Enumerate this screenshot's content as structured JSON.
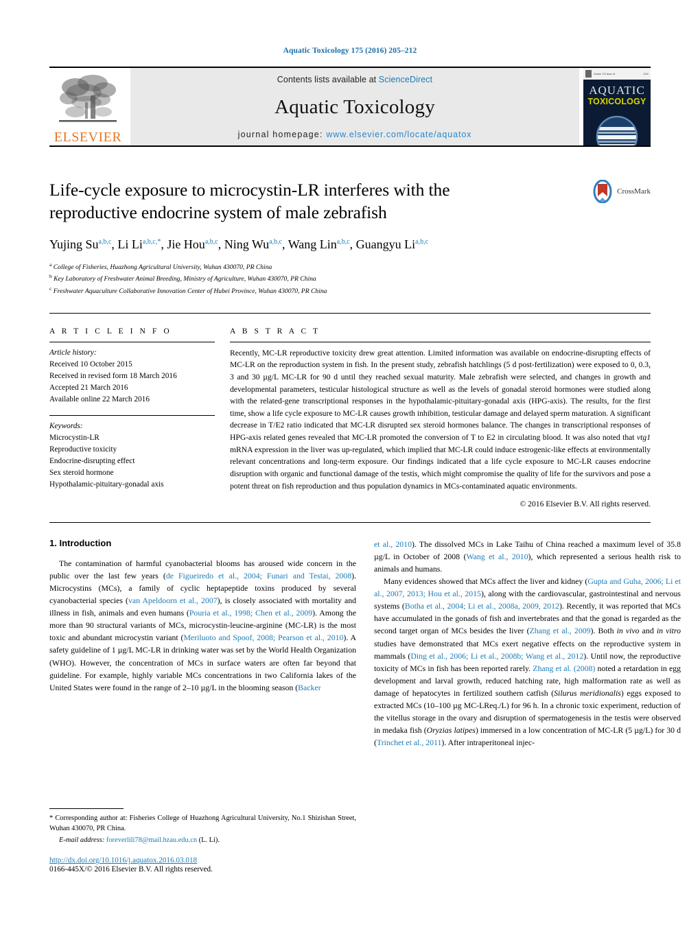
{
  "running_head": "Aquatic Toxicology 175 (2016) 205–212",
  "masthead": {
    "elsevier_label": "ELSEVIER",
    "contents_prefix": "Contents lists available at ",
    "contents_link": "ScienceDirect",
    "journal_title": "Aquatic Toxicology",
    "homepage_prefix": "journal homepage:",
    "homepage_url": "www.elsevier.com/locate/aquatox",
    "cover": {
      "line_aquatic": "AQUATIC",
      "line_toxicology": "TOXICOLOGY",
      "top_left_tiny": "Volume 175  Issue 01",
      "top_right_tiny": "2016"
    }
  },
  "article": {
    "title": "Life-cycle exposure to microcystin-LR interferes with the reproductive endocrine system of male zebrafish",
    "crossmark_label": "CrossMark",
    "authors": [
      {
        "name": "Yujing Su",
        "sup": "a,b,c"
      },
      {
        "name": "Li Li",
        "sup": "a,b,c,"
      },
      {
        "name": "Jie Hou",
        "sup": "a,b,c"
      },
      {
        "name": "Ning Wu",
        "sup": "a,b,c"
      },
      {
        "name": "Wang Lin",
        "sup": "a,b,c"
      },
      {
        "name": "Guangyu Li",
        "sup": "a,b,c"
      }
    ],
    "affiliations": [
      {
        "mark": "a",
        "text": "College of Fisheries, Huazhong Agricultural University, Wuhan 430070, PR China"
      },
      {
        "mark": "b",
        "text": "Key Laboratory of Freshwater Animal Breeding, Ministry of Agriculture, Wuhan 430070, PR China"
      },
      {
        "mark": "c",
        "text": "Freshwater Aquaculture Collaborative Innovation Center of Hubei Province, Wuhan 430070, PR China"
      }
    ]
  },
  "article_info": {
    "heading": "A R T I C L E   I N F O",
    "history_label": "Article history:",
    "history": [
      "Received 10 October 2015",
      "Received in revised form 18 March 2016",
      "Accepted 21 March 2016",
      "Available online 22 March 2016"
    ],
    "keywords_label": "Keywords:",
    "keywords": [
      "Microcystin-LR",
      "Reproductive toxicity",
      "Endocrine-disrupting effect",
      "Sex steroid hormone",
      "Hypothalamic-pituitary-gonadal axis"
    ]
  },
  "abstract": {
    "heading": "A B S T R A C T",
    "text": "Recently, MC-LR reproductive toxicity drew great attention. Limited information was available on endocrine-disrupting effects of MC-LR on the reproduction system in fish. In the present study, zebrafish hatchlings (5 d post-fertilization) were exposed to 0, 0.3, 3 and 30 µg/L MC-LR for 90 d until they reached sexual maturity. Male zebrafish were selected, and changes in growth and developmental parameters, testicular histological structure as well as the levels of gonadal steroid hormones were studied along with the related-gene transcriptional responses in the hypothalamic-pituitary-gonadal axis (HPG-axis). The results, for the first time, show a life cycle exposure to MC-LR causes growth inhibition, testicular damage and delayed sperm maturation. A significant decrease in T/E2 ratio indicated that MC-LR disrupted sex steroid hormones balance. The changes in transcriptional responses of HPG-axis related genes revealed that MC-LR promoted the conversion of T to E2 in circulating blood. It was also noted that ",
    "italic_term": "vtg1",
    "text_after_italic": " mRNA expression in the liver was up-regulated, which implied that MC-LR could induce estrogenic-like effects at environmentally relevant concentrations and long-term exposure. Our findings indicated that a life cycle exposure to MC-LR causes endocrine disruption with organic and functional damage of the testis, which might compromise the quality of life for the survivors and pose a potent threat on fish reproduction and thus population dynamics in MCs-contaminated aquatic environments.",
    "copyright": "© 2016 Elsevier B.V. All rights reserved."
  },
  "introduction": {
    "heading": "1. Introduction",
    "left_p1_a": "The contamination of harmful cyanobacterial blooms has aroused wide concern in the public over the last few years (",
    "left_ref1": "de Figueiredo et al., 2004; Funari and Testai, 2008",
    "left_p1_b": "). Microcystins (MCs), a family of cyclic heptapeptide toxins produced by several cyanobacterial species (",
    "left_ref2": "van Apeldoorn et al., 2007",
    "left_p1_c": "), is closely associated with mortality and illness in fish, animals and even humans (",
    "left_ref3": "Pouria et al., 1998; Chen et al., 2009",
    "left_p1_d": "). Among the more than 90 structural variants of MCs, microcystin-leucine-arginine (MC-LR) is the most toxic and abundant microcystin variant (",
    "left_ref4": "Meriluoto and Spoof, 2008; Pearson et al., 2010",
    "left_p1_e": "). A safety guideline of 1 µg/L MC-LR in drinking water was set by the World Health Organization (WHO). However, the concentration of MCs in surface waters are often far beyond that guideline. For example, highly variable MCs concentrations in two California lakes of the United States were found in the range of 2–10 µg/L in the blooming season (",
    "left_ref5": "Backer",
    "right_cont_ref": "et al., 2010",
    "right_p1_a": "). The dissolved MCs in Lake Taihu of China reached a maximum level of 35.8 µg/L in October of 2008 (",
    "right_ref1": "Wang et al., 2010",
    "right_p1_b": "), which represented a serious health risk to animals and humans.",
    "right_p2_a": "Many evidences showed that MCs affect the liver and kidney (",
    "right_ref2": "Gupta and Guha, 2006; Li et al., 2007, 2013; Hou et al., 2015",
    "right_p2_b": "), along with the cardiovascular, gastrointestinal and nervous systems (",
    "right_ref3": "Botha et al., 2004; Li et al., 2008a, 2009, 2012",
    "right_p2_c": "). Recently, it was reported that MCs have accumulated in the gonads of fish and invertebrates and that the gonad is regarded as the second target organ of MCs besides the liver (",
    "right_ref4": "Zhang et al., 2009",
    "right_p2_d": "). Both ",
    "italic_invivo": "in vivo",
    "right_p2_e": " and ",
    "italic_invitro": "in vitro",
    "right_p2_f": " studies have demonstrated that MCs exert negative effects on the reproductive system in mammals (",
    "right_ref5": "Ding et al., 2006; Li et al., 2008b; Wang et al., 2012",
    "right_p2_g": "). Until now, the reproductive toxicity of MCs in fish has been reported rarely. ",
    "right_ref6": "Zhang et al. (2008)",
    "right_p2_h": " noted a retardation in egg development and larval growth, reduced hatching rate, high malformation rate as well as damage of hepatocytes in fertilized southern catfish (",
    "italic_silurus": "Silurus meridionalis",
    "right_p2_i": ") eggs exposed to extracted MCs (10–100 µg MC-LReq./L) for 96 h. In a chronic toxic experiment, reduction of the vitellus storage in the ovary and disruption of spermatogenesis in the testis were observed in medaka fish (",
    "italic_oryzias": "Oryzias latipes",
    "right_p2_j": ") immersed in a low concentration of MC-LR (5 µg/L) for 30 d (",
    "right_ref7": "Trinchet et al., 2011",
    "right_p2_k": "). After intraperitoneal injec-"
  },
  "footnote": {
    "corresponding": "* Corresponding author at: Fisheries College of Huazhong Agricultural University, No.1 Shizishan Street, Wuhan 430070, PR China.",
    "email_label": "E-mail address:",
    "email": "foreverlili78@mail.hzau.edu.cn",
    "email_suffix": " (L. Li)."
  },
  "footer": {
    "doi": "http://dx.doi.org/10.1016/j.aquatox.2016.03.018",
    "issn": "0166-445X/© 2016 Elsevier B.V. All rights reserved."
  },
  "colors": {
    "link_blue": "#1a7ab5",
    "elsevier_orange": "#e87722",
    "cover_navy": "#0b1b33",
    "cover_yellow": "#d9d400"
  }
}
